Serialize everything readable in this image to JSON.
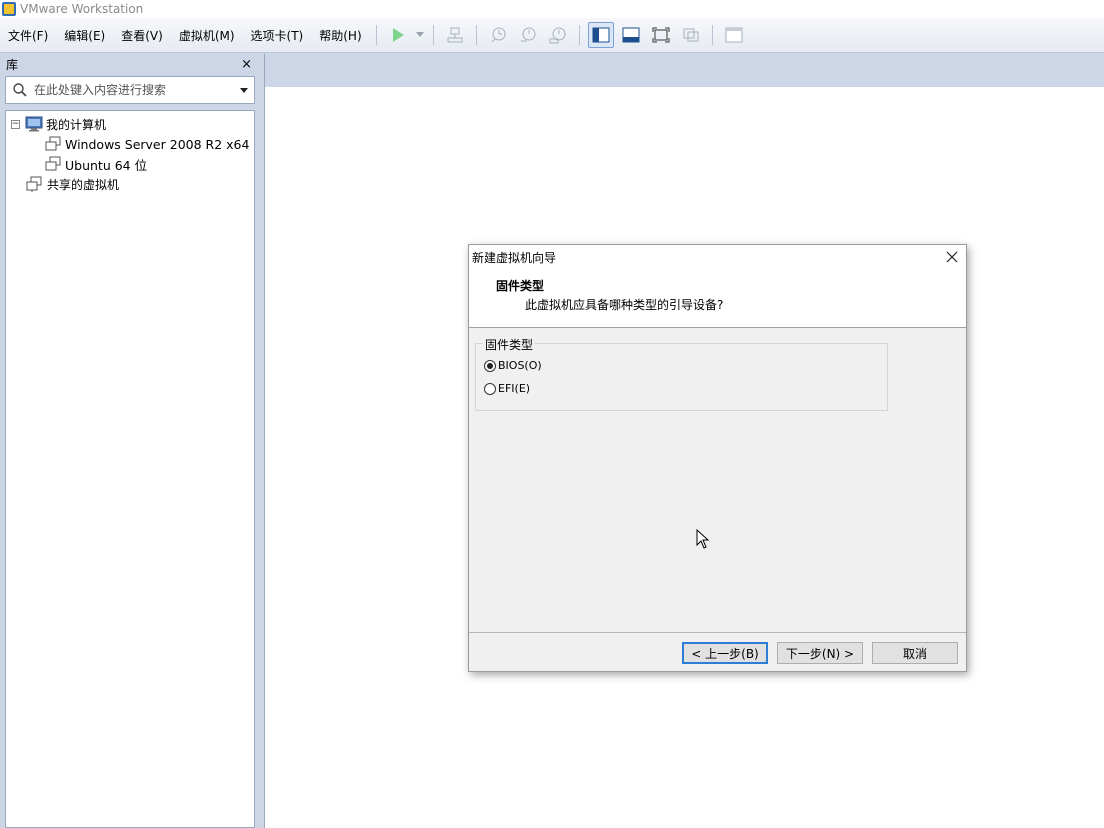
{
  "window": {
    "title": "VMware Workstation"
  },
  "menu": [
    {
      "label": "文件(F)"
    },
    {
      "label": "编辑(E)"
    },
    {
      "label": "查看(V)"
    },
    {
      "label": "虚拟机(M)"
    },
    {
      "label": "选项卡(T)"
    },
    {
      "label": "帮助(H)"
    }
  ],
  "library": {
    "title": "库",
    "close_label": "×",
    "search_placeholder": "在此处键入内容进行搜索",
    "tree": {
      "root": "我的计算机",
      "vms": [
        "Windows Server 2008 R2 x64",
        "Ubuntu 64 位"
      ],
      "shared": "共享的虚拟机"
    }
  },
  "dialog": {
    "title": "新建虚拟机向导",
    "header_title": "固件类型",
    "header_subtitle": "此虚拟机应具备哪种类型的引导设备?",
    "group_label": "固件类型",
    "options": [
      {
        "label": "BIOS(O)",
        "selected": true
      },
      {
        "label": "EFI(E)",
        "selected": false
      }
    ],
    "buttons": {
      "back": "< 上一步(B)",
      "next": "下一步(N) >",
      "cancel": "取消"
    }
  },
  "colors": {
    "accent": "#2d7fd6",
    "chrome_bg": "#cdd6e6",
    "play_green": "#3fbf4f"
  }
}
